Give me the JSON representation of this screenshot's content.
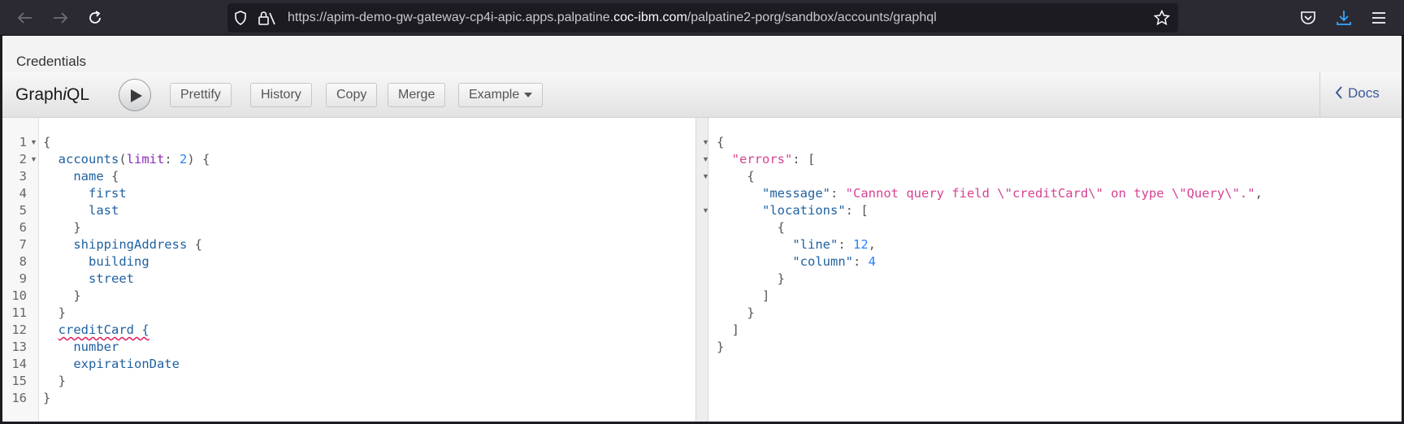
{
  "browser": {
    "url_prefix": "https://apim-demo-gw-gateway-cp4i-apic.apps.palpatine.",
    "url_host": "coc-ibm.com",
    "url_suffix": "/palpatine2-porg/sandbox/accounts/graphql"
  },
  "app": {
    "credentials_label": "Credentials",
    "brand_prefix": "Graph",
    "brand_italic": "i",
    "brand_suffix": "QL",
    "toolbar": {
      "prettify": "Prettify",
      "history": "History",
      "copy": "Copy",
      "merge": "Merge",
      "example": "Example",
      "docs": "Docs"
    }
  },
  "query_lines": [
    "{",
    "  accounts(limit: 2) {",
    "    name {",
    "      first",
    "      last",
    "    }",
    "    shippingAddress {",
    "      building",
    "      street",
    "    }",
    "  }",
    "  creditCard {",
    "    number",
    "    expirationDate",
    "  }",
    "}"
  ],
  "line_numbers": [
    "1",
    "2",
    "3",
    "4",
    "5",
    "6",
    "7",
    "8",
    "9",
    "10",
    "11",
    "12",
    "13",
    "14",
    "15",
    "16"
  ],
  "result": {
    "open_brace": "{",
    "errors_key": "\"errors\"",
    "message_key": "\"message\"",
    "message_value": "\"Cannot query field \\\"creditCard\\\" on type \\\"Query\\\".\"",
    "locations_key": "\"locations\"",
    "line_key": "\"line\"",
    "line_value": "12",
    "column_key": "\"column\"",
    "column_value": "4"
  },
  "colors": {
    "field": "#1f61a0",
    "argument": "#8b2bb9",
    "number": "#2882f9",
    "string": "#d64292"
  }
}
